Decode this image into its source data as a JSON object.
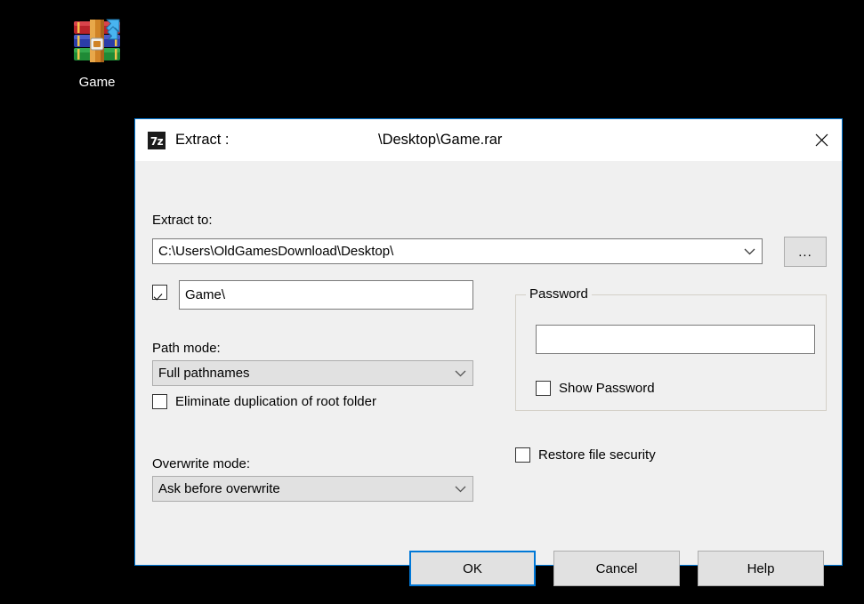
{
  "desktop": {
    "icons": [
      {
        "label": "Game",
        "icon": "winrar-archive-icon"
      }
    ]
  },
  "dialog": {
    "titlebar": {
      "app_icon": "sevenzip-icon",
      "app_icon_text": "7z",
      "title": "Extract :",
      "archive_path": "\\Desktop\\Game.rar",
      "close_icon": "close-icon"
    },
    "extract_to": {
      "label": "Extract to:",
      "value": "C:\\Users\\OldGamesDownload\\Desktop\\",
      "dropdown_icon": "chevron-down-icon",
      "browse_label": "...",
      "browse_icon": "ellipsis-icon"
    },
    "subfolder": {
      "checked": true,
      "value": "Game\\"
    },
    "path_mode": {
      "label": "Path mode:",
      "value": "Full pathnames",
      "dropdown_icon": "chevron-down-icon"
    },
    "eliminate_duplication": {
      "label": "Eliminate duplication of root folder",
      "checked": false
    },
    "overwrite_mode": {
      "label": "Overwrite mode:",
      "value": "Ask before overwrite",
      "dropdown_icon": "chevron-down-icon"
    },
    "password": {
      "group_label": "Password",
      "value": "",
      "placeholder": "",
      "show_password_label": "Show Password",
      "show_password_checked": false
    },
    "restore_file_security": {
      "label": "Restore file security",
      "checked": false
    },
    "buttons": {
      "ok": "OK",
      "cancel": "Cancel",
      "help": "Help"
    },
    "colors": {
      "accent": "#0078d7",
      "dialog_bg": "#f0f0f0",
      "titlebar_bg": "#ffffff",
      "button_bg": "#e1e1e1",
      "desktop_bg": "#000000"
    }
  }
}
